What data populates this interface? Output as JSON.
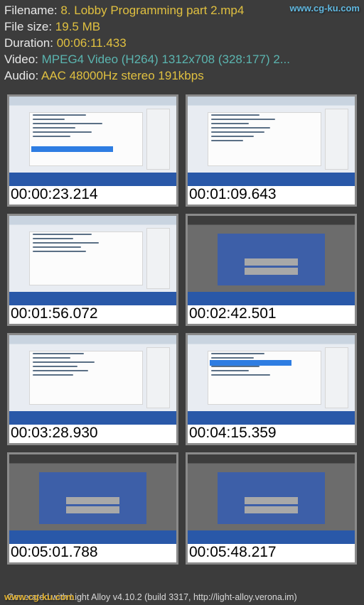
{
  "watermarks": {
    "top": "www.cg-ku.com",
    "bottom": "www.cg-ku.com"
  },
  "info": {
    "filename_label": "Filename: ",
    "filename_value": "8. Lobby Programming part 2.mp4",
    "filesize_label": "File size: ",
    "filesize_value": "19.5 MB",
    "duration_label": "Duration: ",
    "duration_value": "00:06:11.433",
    "video_label": "Video: ",
    "video_value": "MPEG4 Video (H264) 1312x708 (328:177) 2...",
    "audio_label": "Audio: ",
    "audio_value": "AAC 48000Hz stereo 191kbps"
  },
  "thumbnails": [
    {
      "timestamp": "00:00:23.214",
      "variant": "editor"
    },
    {
      "timestamp": "00:01:09.643",
      "variant": "editor"
    },
    {
      "timestamp": "00:01:56.072",
      "variant": "editor"
    },
    {
      "timestamp": "00:02:42.501",
      "variant": "unity"
    },
    {
      "timestamp": "00:03:28.930",
      "variant": "editor"
    },
    {
      "timestamp": "00:04:15.359",
      "variant": "editor"
    },
    {
      "timestamp": "00:05:01.788",
      "variant": "unity"
    },
    {
      "timestamp": "00:05:48.217",
      "variant": "unity"
    }
  ],
  "footer": "Generated with Light Alloy v4.10.2 (build 3317, http://light-alloy.verona.im)"
}
